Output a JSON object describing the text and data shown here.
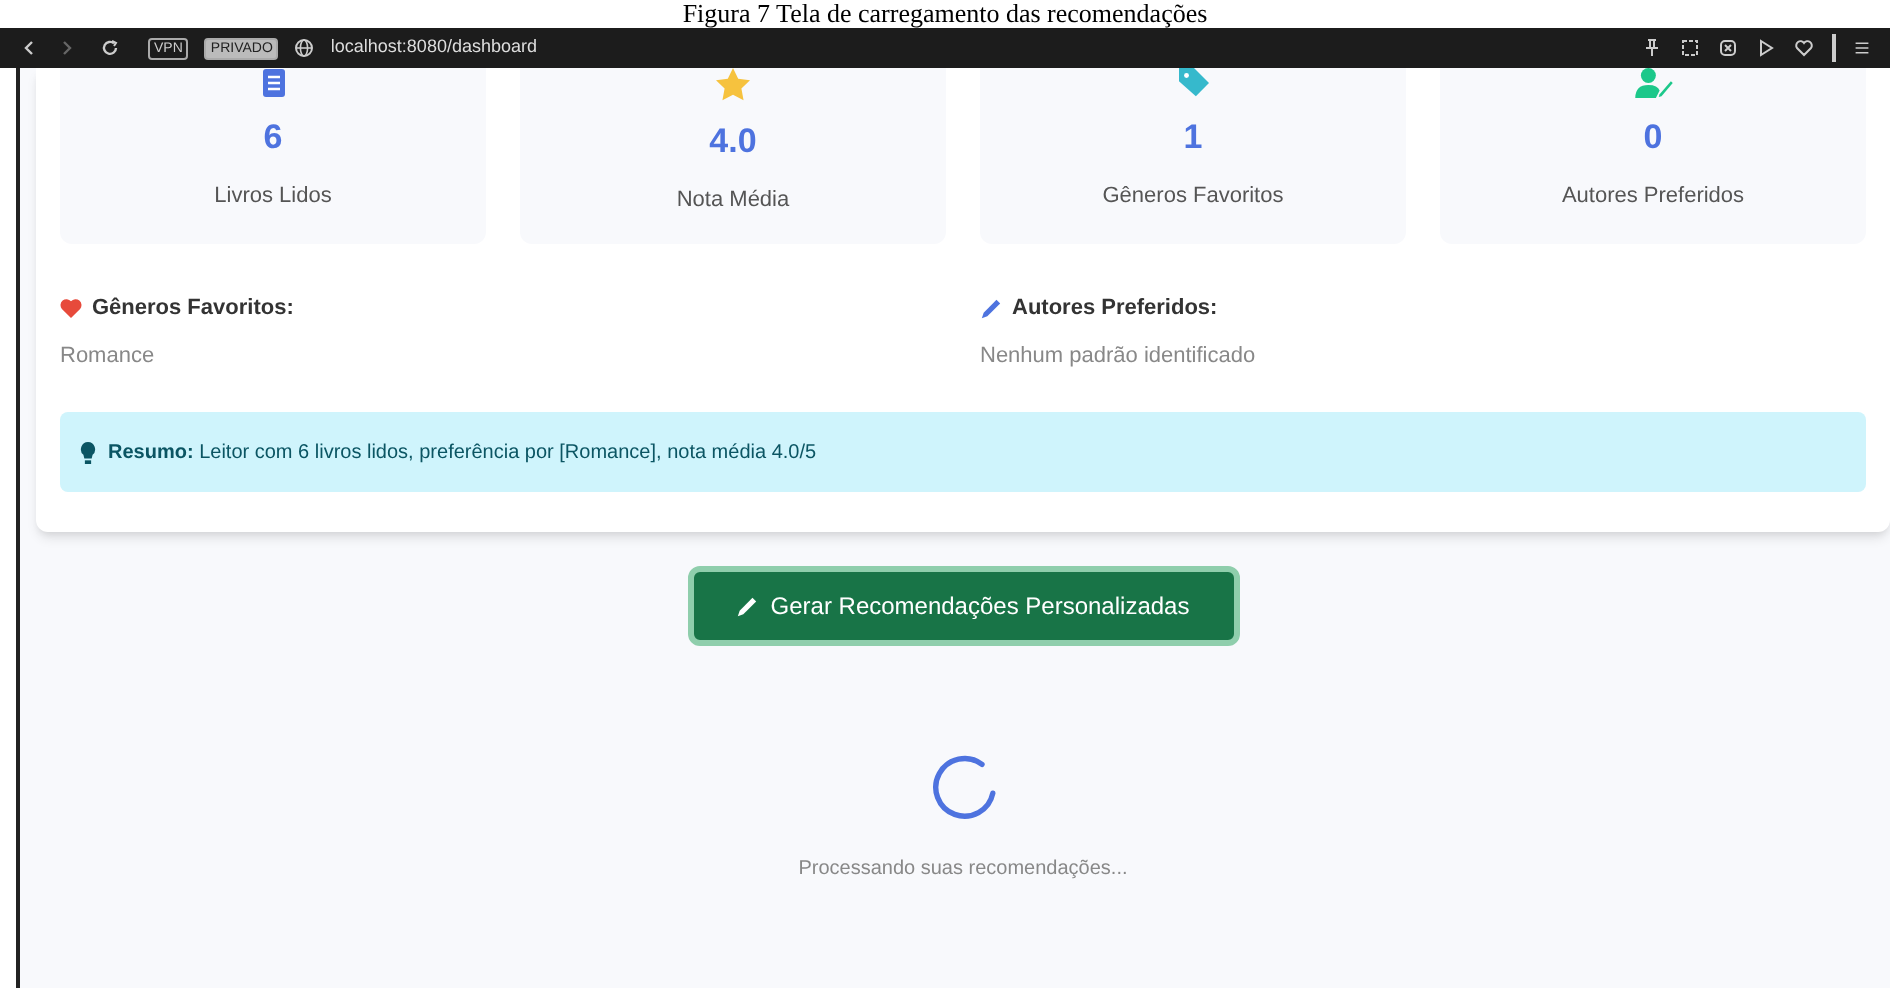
{
  "caption": "Figura 7 Tela de carregamento das recomendações",
  "browser": {
    "badges": [
      "VPN",
      "PRIVADO"
    ],
    "url": "localhost:8080/dashboard"
  },
  "stats": [
    {
      "kind": "book",
      "value": "6",
      "label": "Livros Lidos"
    },
    {
      "kind": "star",
      "value": "4.0",
      "label": "Nota Média"
    },
    {
      "kind": "tag",
      "value": "1",
      "label": "Gêneros Favoritos"
    },
    {
      "kind": "user",
      "value": "0",
      "label": "Autores Preferidos"
    }
  ],
  "preferences": [
    {
      "kind": "heart",
      "title": "Gêneros Favoritos:",
      "text": "Romance"
    },
    {
      "kind": "pen",
      "title": "Autores Preferidos:",
      "text": "Nenhum padrão identificado"
    }
  ],
  "summary": {
    "text": "**Resumo:** Leitor com 6 livros lidos, preferência por [Romance], nota média 4.0/5"
  },
  "generate_button": {
    "label": "Gerar Recomendações Personalizadas"
  },
  "loading": {
    "text": "Processando suas recomendações..."
  }
}
